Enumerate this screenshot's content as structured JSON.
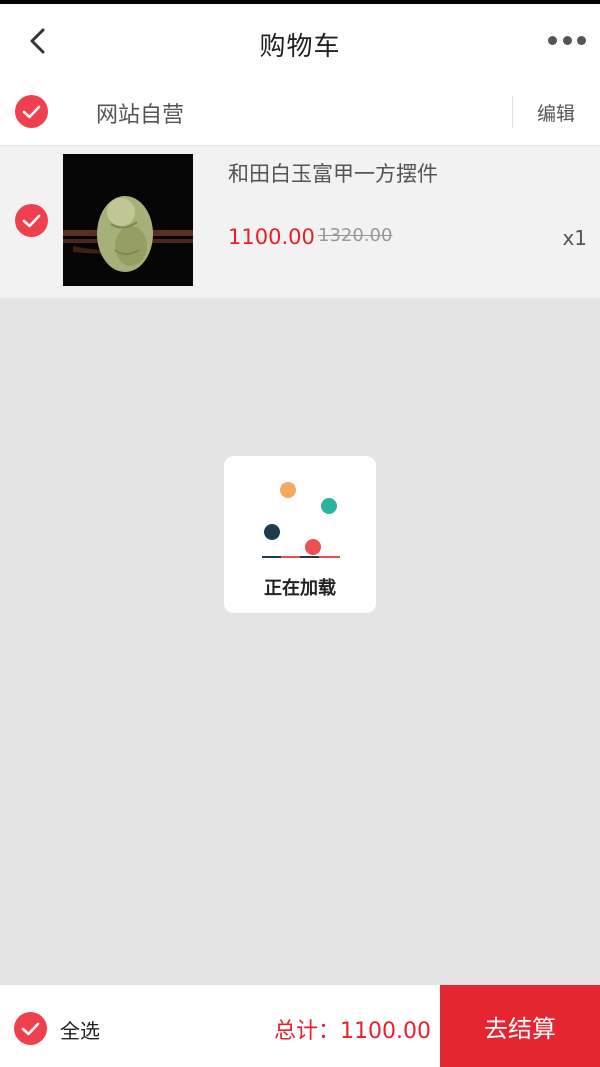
{
  "nav": {
    "title": "购物车",
    "back_icon": "chevron-left-icon",
    "more_icon": "more-dots-icon"
  },
  "shop": {
    "name": "网站自营",
    "edit_label": "编辑",
    "selected": true
  },
  "cart_items": [
    {
      "title": "和田白玉富甲一方摆件",
      "price": "1100.00",
      "original_price": "1320.00",
      "quantity": "x1",
      "selected": true
    }
  ],
  "loading": {
    "text": "正在加载"
  },
  "footer": {
    "select_all_label": "全选",
    "total": "总计：1100.00",
    "checkout_label": "去结算"
  },
  "colors": {
    "accent": "#e5252f",
    "check": "#f0404e",
    "price": "#e8202e",
    "loader_orange": "#f5a95c",
    "loader_teal": "#2bb39e",
    "loader_navy": "#1f3b4d",
    "loader_red": "#ee4f4f"
  }
}
